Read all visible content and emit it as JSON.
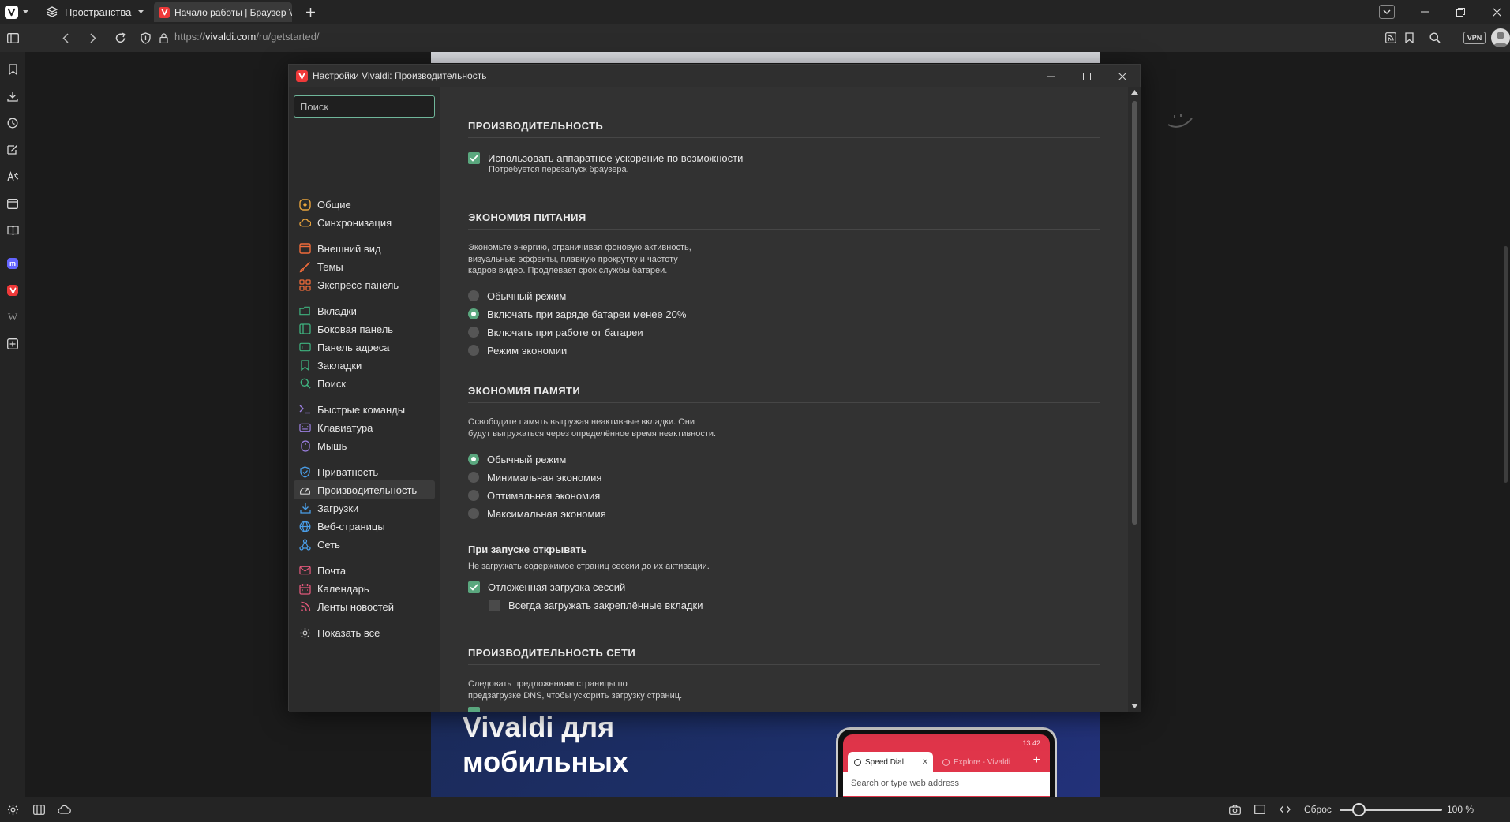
{
  "browser": {
    "spaces_label": "Пространства",
    "active_tab_title": "Начало работы | Браузер Vivaldi",
    "url_prefix": "https://",
    "url_domain": "vivaldi.com",
    "url_path": "/ru/getstarted/",
    "vpn_label": "VPN"
  },
  "settings": {
    "window_title": "Настройки Vivaldi: Производительность",
    "search_placeholder": "Поиск",
    "nav": [
      {
        "label": "Общие",
        "icon": "general-icon",
        "color": "#e8a33c"
      },
      {
        "label": "Синхронизация",
        "icon": "cloud-icon",
        "color": "#e8a33c"
      },
      {
        "label": "Внешний вид",
        "icon": "appearance-icon",
        "color": "#ef6b3a"
      },
      {
        "label": "Темы",
        "icon": "brush-icon",
        "color": "#ef6b3a"
      },
      {
        "label": "Экспресс-панель",
        "icon": "speed-dial-icon",
        "color": "#ef6b3a"
      },
      {
        "label": "Вкладки",
        "icon": "tabs-icon",
        "color": "#3fb37f"
      },
      {
        "label": "Боковая панель",
        "icon": "panel-icon",
        "color": "#3fb37f"
      },
      {
        "label": "Панель адреса",
        "icon": "address-bar-icon",
        "color": "#3fb37f"
      },
      {
        "label": "Закладки",
        "icon": "bookmark-icon",
        "color": "#3fb37f"
      },
      {
        "label": "Поиск",
        "icon": "search-icon",
        "color": "#3fb37f"
      },
      {
        "label": "Быстрые команды",
        "icon": "quick-commands-icon",
        "color": "#9b7fe0"
      },
      {
        "label": "Клавиатура",
        "icon": "keyboard-icon",
        "color": "#9b7fe0"
      },
      {
        "label": "Мышь",
        "icon": "mouse-icon",
        "color": "#9b7fe0"
      },
      {
        "label": "Приватность",
        "icon": "shield-icon",
        "color": "#4a9ee8"
      },
      {
        "label": "Производительность",
        "icon": "gauge-icon",
        "color": "#d0d0d0"
      },
      {
        "label": "Загрузки",
        "icon": "download-icon",
        "color": "#4a9ee8"
      },
      {
        "label": "Веб-страницы",
        "icon": "globe-icon",
        "color": "#4a9ee8"
      },
      {
        "label": "Сеть",
        "icon": "network-icon",
        "color": "#4a9ee8"
      },
      {
        "label": "Почта",
        "icon": "mail-icon",
        "color": "#e0587a"
      },
      {
        "label": "Календарь",
        "icon": "calendar-icon",
        "color": "#e0587a"
      },
      {
        "label": "Ленты новостей",
        "icon": "feed-icon",
        "color": "#e0587a"
      },
      {
        "label": "Показать все",
        "icon": "gear-icon",
        "color": "#c8c8c8"
      }
    ],
    "performance": {
      "heading": "ПРОИЗВОДИТЕЛЬНОСТЬ",
      "hw_accel_label": "Использовать аппаратное ускорение по возможности",
      "hw_accel_note": "Потребуется перезапуск браузера.",
      "hw_accel_checked": true
    },
    "power": {
      "heading": "ЭКОНОМИЯ ПИТАНИЯ",
      "desc_lines": [
        "Экономьте энергию, ограничивая фоновую активность,",
        "визуальные эффекты, плавную прокрутку и частоту",
        "кадров видео. Продлевает срок службы батареи."
      ],
      "options": [
        {
          "label": "Обычный режим",
          "selected": false
        },
        {
          "label": "Включать при заряде батареи менее 20%",
          "selected": true
        },
        {
          "label": "Включать при работе от батареи",
          "selected": false
        },
        {
          "label": "Режим экономии",
          "selected": false
        }
      ]
    },
    "memory": {
      "heading": "ЭКОНОМИЯ ПАМЯТИ",
      "desc_lines": [
        "Освободите память выгружая неактивные вкладки. Они",
        "будут выгружаться через определённое время неактивности."
      ],
      "options": [
        {
          "label": "Обычный режим",
          "selected": true
        },
        {
          "label": "Минимальная экономия",
          "selected": false
        },
        {
          "label": "Оптимальная экономия",
          "selected": false
        },
        {
          "label": "Максимальная экономия",
          "selected": false
        }
      ]
    },
    "startup": {
      "heading": "При запуске открывать",
      "desc": "Не загружать содержимое страниц сессии до их активации.",
      "lazy_load_label": "Отложенная загрузка сессий",
      "lazy_load_checked": true,
      "pinned_label": "Всегда загружать закреплённые вкладки",
      "pinned_checked": false
    },
    "network": {
      "heading": "ПРОИЗВОДИТЕЛЬНОСТЬ СЕТИ",
      "desc_lines": [
        "Следовать предложениям страницы по",
        "предзагрузке DNS, чтобы ускорить загрузку страниц."
      ]
    }
  },
  "page": {
    "mobile_heading_line1": "Vivaldi для",
    "mobile_heading_line2": "мобильных",
    "phone_tab1": "Speed Dial",
    "phone_tab2": "Explore - Vivaldi",
    "phone_url_placeholder": "Search or type web address",
    "phone_time": "13:42"
  },
  "statusbar": {
    "reset_label": "Сброс",
    "zoom_label": "100 %",
    "zoom_percent": 100
  },
  "colors": {
    "accent": "#5aa77e",
    "vivaldi_red": "#ef3939"
  }
}
